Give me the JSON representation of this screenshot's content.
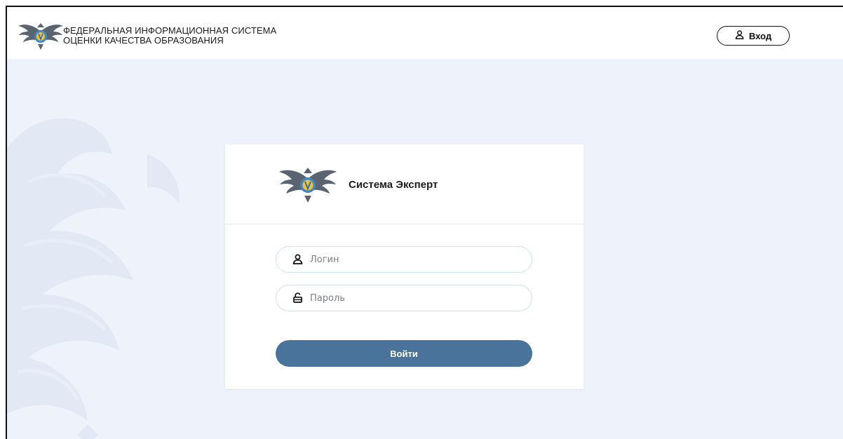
{
  "header": {
    "title_line1": "ФЕДЕРАЛЬНАЯ ИНФОРМАЦИОННАЯ СИСТЕМА",
    "title_line2": "ОЦЕНКИ КАЧЕСТВА ОБРАЗОВАНИЯ",
    "logo_icon": "eagle-emblem-icon",
    "login_button": {
      "label": "Вход",
      "icon": "user-icon"
    }
  },
  "login_card": {
    "logo_icon": "eagle-emblem-icon",
    "title": "Система Эксперт",
    "login_field": {
      "placeholder": "Логин",
      "value": "",
      "icon": "user-icon"
    },
    "password_field": {
      "placeholder": "Пароль",
      "value": "",
      "icon": "lock-icon"
    },
    "submit_label": "Войти"
  },
  "colors": {
    "page_background": "#eef3fb",
    "submit_button": "#4a739c",
    "field_border": "#cfe0f0",
    "text": "#1a1a1a"
  }
}
